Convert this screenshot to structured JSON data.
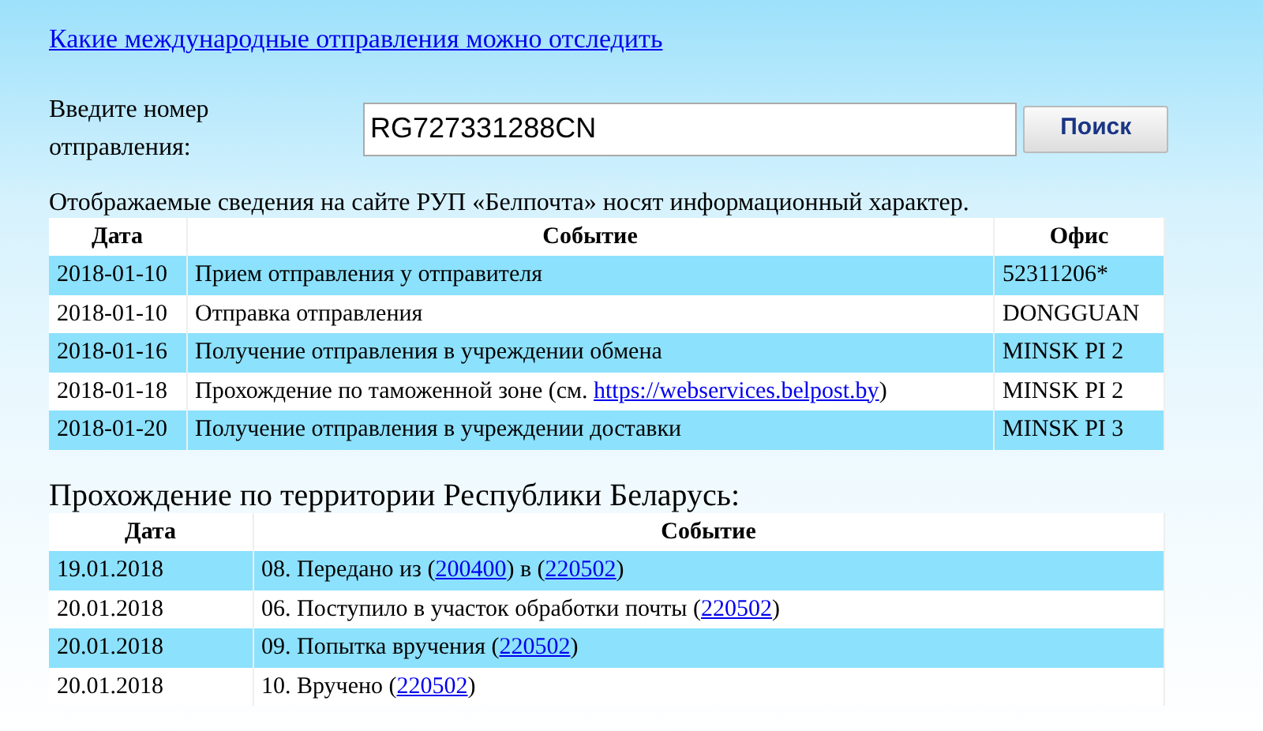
{
  "top_link": "Какие международные отправления можно отследить",
  "search": {
    "label": "Введите номер отправления:",
    "value": "RG727331288CN",
    "button": "Поиск"
  },
  "notice": "Отображаемые сведения на сайте РУП «Белпочта» носят информационный характер.",
  "international": {
    "columns": [
      "Дата",
      "Событие",
      "Офис"
    ],
    "rows": [
      {
        "date": "2018-01-10",
        "event": [
          {
            "text": "Прием отправления у отправителя"
          }
        ],
        "office": "52311206*"
      },
      {
        "date": "2018-01-10",
        "event": [
          {
            "text": "Отправка отправления"
          }
        ],
        "office": "DONGGUAN"
      },
      {
        "date": "2018-01-16",
        "event": [
          {
            "text": "Получение отправления в учреждении обмена"
          }
        ],
        "office": "MINSK PI 2"
      },
      {
        "date": "2018-01-18",
        "event": [
          {
            "text": "Прохождение по таможенной зоне (см. "
          },
          {
            "link": "https://webservices.belpost.by"
          },
          {
            "text": ")"
          }
        ],
        "office": "MINSK PI 2"
      },
      {
        "date": "2018-01-20",
        "event": [
          {
            "text": "Получение отправления в учреждении доставки"
          }
        ],
        "office": "MINSK PI 3"
      }
    ]
  },
  "domestic": {
    "title": "Прохождение по территории Республики Беларусь:",
    "columns": [
      "Дата",
      "Событие"
    ],
    "rows": [
      {
        "date": "19.01.2018",
        "event": [
          {
            "text": "08. Передано из ("
          },
          {
            "link": "200400"
          },
          {
            "text": ") в ("
          },
          {
            "link": "220502"
          },
          {
            "text": ")"
          }
        ]
      },
      {
        "date": "20.01.2018",
        "event": [
          {
            "text": "06. Поступило в участок обработки почты ("
          },
          {
            "link": "220502"
          },
          {
            "text": ")"
          }
        ]
      },
      {
        "date": "20.01.2018",
        "event": [
          {
            "text": "09. Попытка вручения ("
          },
          {
            "link": "220502"
          },
          {
            "text": ")"
          }
        ]
      },
      {
        "date": "20.01.2018",
        "event": [
          {
            "text": "10. Вручено ("
          },
          {
            "link": "220502"
          },
          {
            "text": ")"
          }
        ]
      }
    ]
  }
}
